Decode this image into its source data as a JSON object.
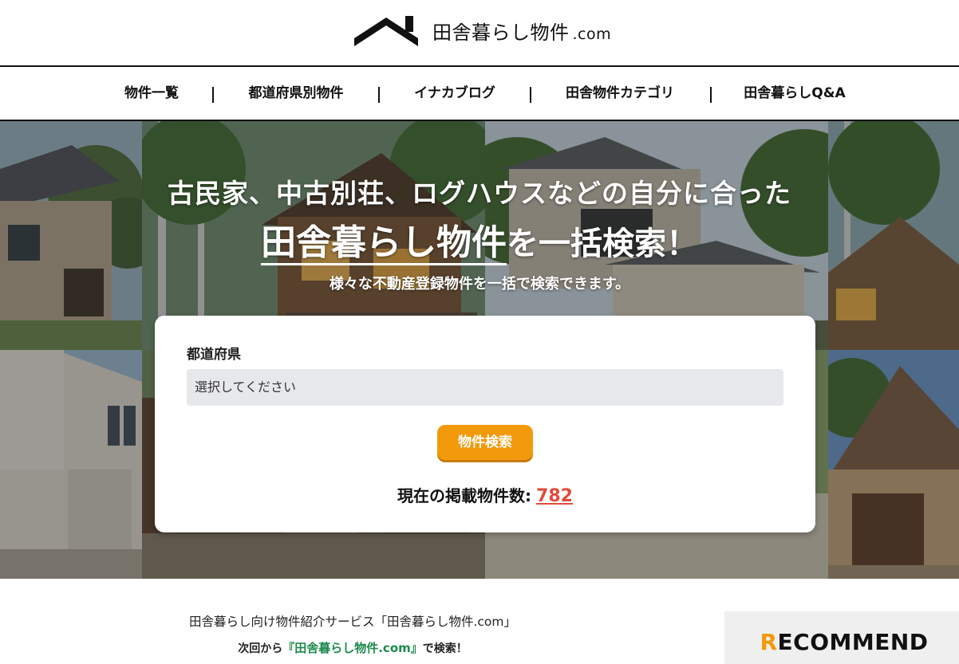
{
  "header": {
    "logo_icon": "house-roof-icon",
    "logo_text": "田舎暮らし物件",
    "logo_suffix": ".com"
  },
  "nav": {
    "items": [
      {
        "label": "物件一覧"
      },
      {
        "label": "都道府県別物件"
      },
      {
        "label": "イナカブログ"
      },
      {
        "label": "田舎物件カテゴリ"
      },
      {
        "label": "田舎暮らしQ&A"
      }
    ]
  },
  "hero": {
    "line1": "古民家、中古別荘、ログハウスなどの自分に合った",
    "emphasis": "田舎暮らし物件",
    "line2_rest": "を一括検索！",
    "subtitle": "様々な不動産登録物件を一括で検索できます。"
  },
  "search": {
    "prefecture_label": "都道府県",
    "prefecture_value": "選択してください",
    "button_label": "物件検索",
    "count_label": "現在の掲載物件数:",
    "count_value": "782"
  },
  "footer_intro": {
    "text": "田舎暮らし向け物件紹介サービス「田舎暮らし物件.com」",
    "next_prefix": "次回から",
    "next_site": "『田舎暮らし物件.com』",
    "next_suffix": "で検索！"
  },
  "recommend": {
    "first_letter": "R",
    "rest": "ECOMMEND"
  },
  "colors": {
    "accent": "#f29a0b",
    "count": "#e24a3b",
    "site_green": "#1d8a4c",
    "select_bg": "#e7e8eb"
  }
}
